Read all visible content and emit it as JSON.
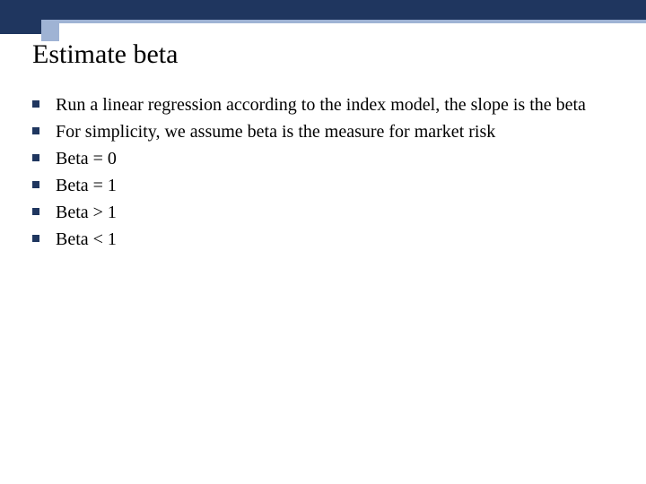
{
  "title": "Estimate beta",
  "bullets": [
    "Run a linear regression according to the index model, the slope is the beta",
    "For simplicity, we assume beta is the measure for market risk",
    "Beta = 0",
    "Beta = 1",
    "Beta > 1",
    "Beta < 1"
  ],
  "colors": {
    "darkBlue": "#1f365f",
    "lightBlue": "#9fb3d4"
  }
}
